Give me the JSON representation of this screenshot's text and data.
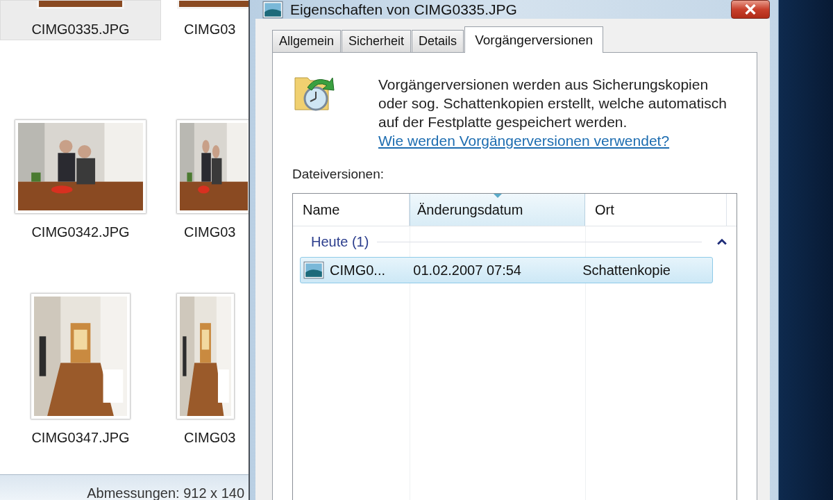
{
  "explorer": {
    "files": [
      {
        "name": "CIMG0335.JPG",
        "selected": true
      },
      {
        "name": "CIMG03",
        "selected": false
      },
      {
        "name": "CIMG0342.JPG",
        "selected": false
      },
      {
        "name": "CIMG03",
        "selected": false
      },
      {
        "name": "CIMG0347.JPG",
        "selected": false
      },
      {
        "name": "CIMG03",
        "selected": false
      }
    ],
    "status_bar": "Abmessungen: 912 x 140"
  },
  "dialog": {
    "title": "Eigenschaften von CIMG0335.JPG",
    "tabs": [
      {
        "label": "Allgemein",
        "selected": false
      },
      {
        "label": "Sicherheit",
        "selected": false
      },
      {
        "label": "Details",
        "selected": false
      },
      {
        "label": "Vorgängerversionen",
        "selected": true
      }
    ],
    "description": "Vorgängerversionen werden aus Sicherungskopien oder sog. Schattenkopien erstellt, welche automatisch auf der Festplatte gespeichert werden.",
    "help_link": "Wie werden Vorgängerversionen verwendet?",
    "list_label": "Dateiversionen:",
    "columns": [
      {
        "label": "Name",
        "sorted": false
      },
      {
        "label": "Änderungsdatum",
        "sorted": true
      },
      {
        "label": "Ort",
        "sorted": false
      }
    ],
    "groups": [
      {
        "label": "Heute (1)",
        "expanded": true,
        "rows": [
          {
            "name": "CIMG0...",
            "date": "01.02.2007 07:54",
            "location": "Schattenkopie",
            "selected": true
          }
        ]
      }
    ]
  }
}
